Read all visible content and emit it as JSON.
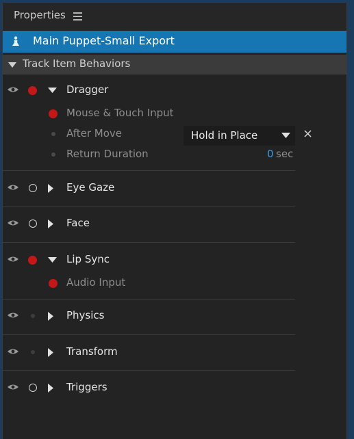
{
  "panel": {
    "title": "Properties",
    "menu_icon": "hamburger-menu-icon"
  },
  "puppet": {
    "name": "Main Puppet-Small Export",
    "icon": "puppet-icon"
  },
  "section": {
    "label": "Track Item Behaviors",
    "icon": "triangle-down-icon"
  },
  "colors": {
    "accent": "#1676b3",
    "armed_red": "#c41818",
    "value_blue": "#3e9bea",
    "background": "#232323",
    "outer": "#1c3c5e"
  },
  "behaviors": [
    {
      "label": "Dragger",
      "visible": true,
      "armed": "red",
      "expanded": true
    },
    {
      "label": "Eye Gaze",
      "visible": true,
      "armed": "open",
      "expanded": false
    },
    {
      "label": "Face",
      "visible": true,
      "armed": "open",
      "expanded": false
    },
    {
      "label": "Lip Sync",
      "visible": true,
      "armed": "red",
      "expanded": true
    },
    {
      "label": "Physics",
      "visible": true,
      "armed": "none",
      "expanded": false
    },
    {
      "label": "Transform",
      "visible": true,
      "armed": "none",
      "expanded": false
    },
    {
      "label": "Triggers",
      "visible": true,
      "armed": "open",
      "expanded": false
    }
  ],
  "dragger": {
    "input_label": "Mouse & Touch Input",
    "after_move": {
      "label": "After Move",
      "value": "Hold in Place"
    },
    "return_duration": {
      "label": "Return Duration",
      "value": "0",
      "unit": "sec"
    }
  },
  "lip_sync": {
    "input_label": "Audio Input"
  }
}
